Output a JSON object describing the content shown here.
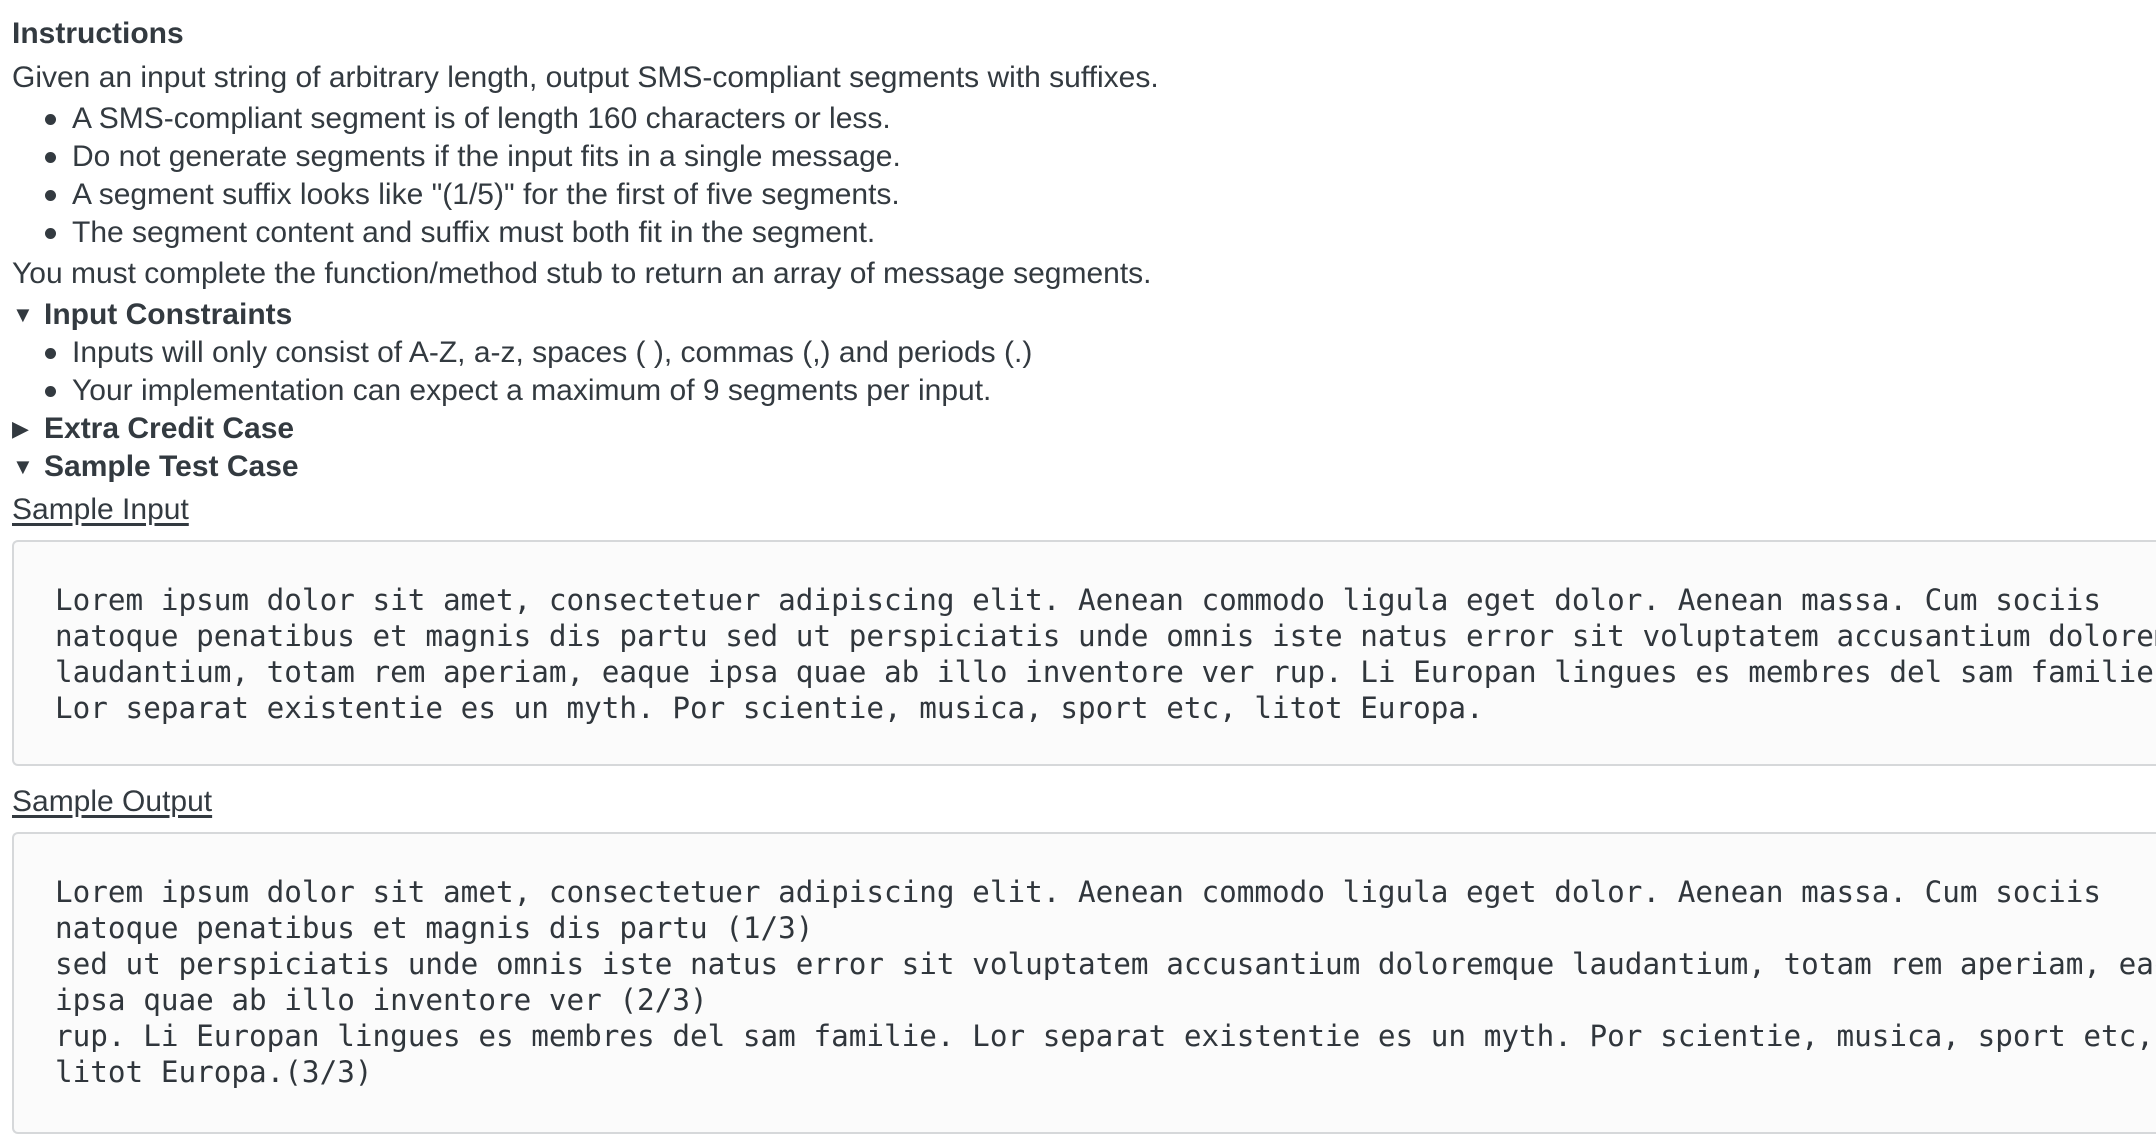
{
  "instructions": {
    "heading": "Instructions",
    "intro": "Given an input string of arbitrary length, output SMS-compliant segments with suffixes.",
    "bullets": [
      "A SMS-compliant segment is of length 160 characters or less.",
      "Do not generate segments if the input fits in a single message.",
      "A segment suffix looks like \"(1/5)\" for the first of five segments.",
      "The segment content and suffix must both fit in the segment."
    ],
    "closing": "You must complete the function/method stub to return an array of message segments."
  },
  "sections": {
    "input_constraints": {
      "label": "Input Constraints",
      "marker": "▼",
      "bullets": [
        "Inputs will only consist of A-Z, a-z, spaces ( ), commas (,) and periods (.)",
        "Your implementation can expect a maximum of 9 segments per input."
      ]
    },
    "extra_credit": {
      "label": "Extra Credit Case",
      "marker": "▶"
    },
    "sample_test": {
      "label": "Sample Test Case",
      "marker": "▼",
      "input_label": "Sample Input",
      "input_text": "Lorem ipsum dolor sit amet, consectetuer adipiscing elit. Aenean commodo ligula eget dolor. Aenean massa. Cum sociis\nnatoque penatibus et magnis dis partu sed ut perspiciatis unde omnis iste natus error sit voluptatem accusantium doloremque\nlaudantium, totam rem aperiam, eaque ipsa quae ab illo inventore ver rup. Li Europan lingues es membres del sam familie.\nLor separat existentie es un myth. Por scientie, musica, sport etc, litot Europa.",
      "output_label": "Sample Output",
      "output_text": "Lorem ipsum dolor sit amet, consectetuer adipiscing elit. Aenean commodo ligula eget dolor. Aenean massa. Cum sociis\nnatoque penatibus et magnis dis partu (1/3)\nsed ut perspiciatis unde omnis iste natus error sit voluptatem accusantium doloremque laudantium, totam rem aperiam, eaque\nipsa quae ab illo inventore ver (2/3)\nrup. Li Europan lingues es membres del sam familie. Lor separat existentie es un myth. Por scientie, musica, sport etc,\nlitot Europa.(3/3)"
    }
  }
}
